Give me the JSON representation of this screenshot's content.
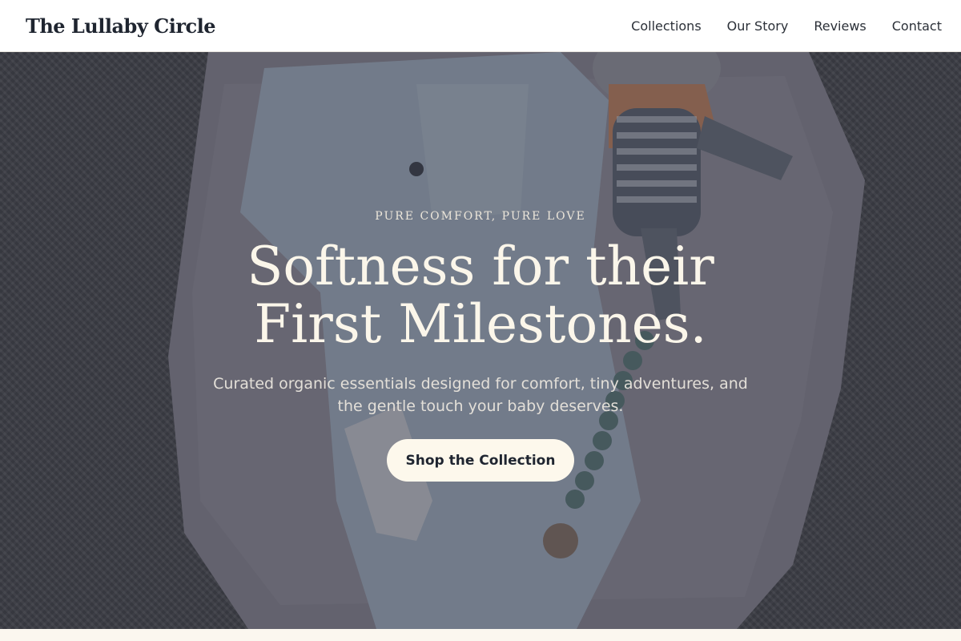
{
  "header": {
    "brand": "The Lullaby Circle",
    "nav": [
      "Collections",
      "Our Story",
      "Reviews",
      "Contact"
    ]
  },
  "hero": {
    "eyebrow": "PURE COMFORT, PURE LOVE",
    "headline_line1": "Softness for their",
    "headline_line2": "First Milestones.",
    "subtext": "Curated organic essentials designed for comfort, tiny adventures, and the gentle touch your baby deserves.",
    "cta_label": "Shop the Collection"
  },
  "colors": {
    "header_bg": "#ffffff",
    "brand_text": "#1f2530",
    "hero_overlay": "#262c3a",
    "cta_bg": "#fdf8ec",
    "page_bg": "#fbf7ef"
  },
  "image": {
    "description_icons": [
      "knit-blanket-background",
      "muslin-blanket",
      "baby-romper",
      "plush-toy",
      "pacifier-clip",
      "baby-sock"
    ]
  }
}
